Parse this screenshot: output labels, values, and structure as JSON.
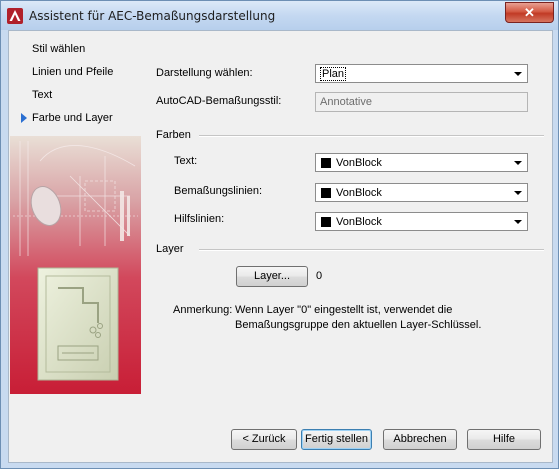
{
  "window": {
    "title": "Assistent für AEC-Bemaßungsdarstellung",
    "close_label": "✕"
  },
  "nav": {
    "items": [
      {
        "label": "Stil wählen"
      },
      {
        "label": "Linien und Pfeile"
      },
      {
        "label": "Text"
      },
      {
        "label": "Farbe und Layer",
        "current": true
      }
    ]
  },
  "form": {
    "darstellung_label": "Darstellung wählen:",
    "darstellung_value": "Plan",
    "bemstil_label": "AutoCAD-Bemaßungsstil:",
    "bemstil_value": "Annotative",
    "farben_heading": "Farben",
    "text_label": "Text:",
    "text_value": "VonBlock",
    "bemlinien_label": "Bemaßungslinien:",
    "bemlinien_value": "VonBlock",
    "hilfslinien_label": "Hilfslinien:",
    "hilfslinien_value": "VonBlock",
    "layer_heading": "Layer",
    "layer_button": "Layer...",
    "layer_value": "0",
    "note_label": "Anmerkung:",
    "note_line1": "Wenn Layer \"0\" eingestellt ist, verwendet die",
    "note_line2": "Bemaßungsgruppe den aktuellen Layer-Schlüssel."
  },
  "buttons": {
    "back": "< Zurück",
    "finish": "Fertig stellen",
    "cancel": "Abbrechen",
    "help": "Hilfe"
  },
  "colors": {
    "accent_nav_arrow": "#2a6fd1",
    "swatch": "#000000",
    "art_red": "#c8203a"
  }
}
